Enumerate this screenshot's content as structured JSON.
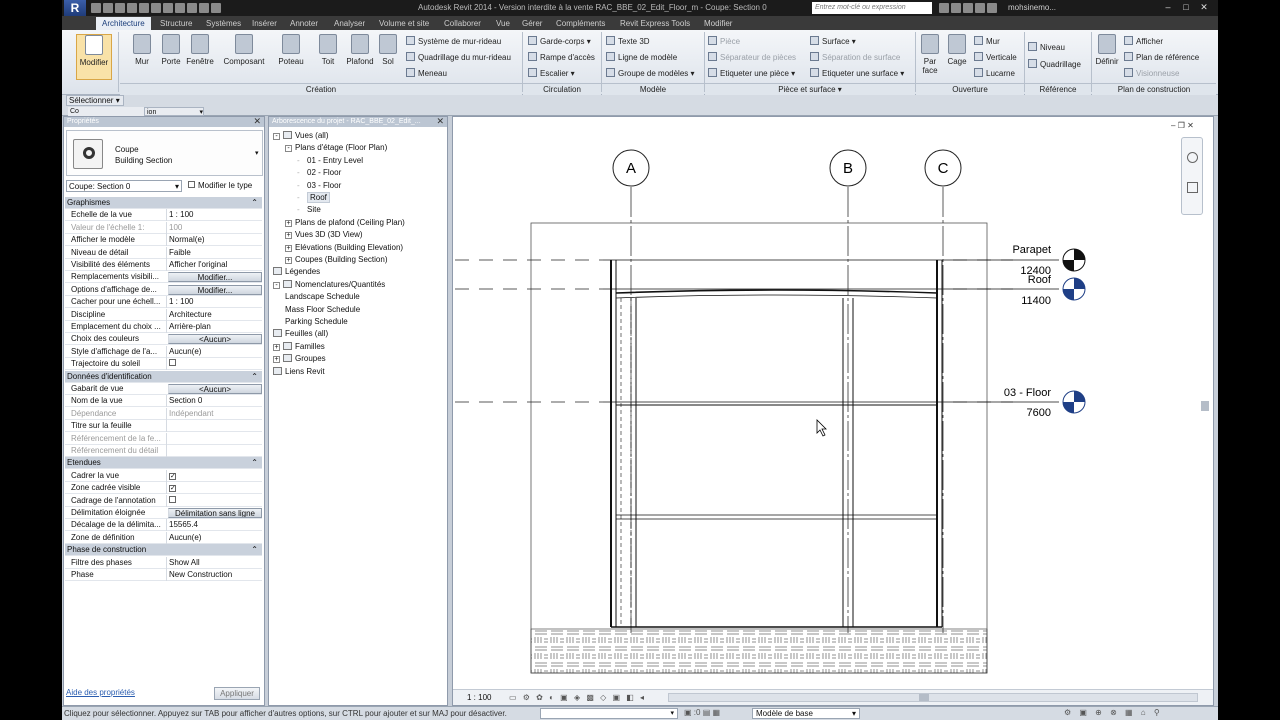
{
  "titlebar": {
    "title": "Autodesk Revit 2014 - Version interdite à la vente    RAC_BBE_02_Edit_Floor_m - Coupe: Section 0",
    "search_placeholder": "Entrez mot-clé ou expression",
    "user": "mohsinemo..."
  },
  "tabs": [
    "Architecture",
    "Structure",
    "Systèmes",
    "Insérer",
    "Annoter",
    "Analyser",
    "Volume et site",
    "Collaborer",
    "Vue",
    "Gérer",
    "Compléments",
    "Revit Express Tools",
    "Modifier"
  ],
  "ribbon": {
    "modify": "Modifier",
    "creation": {
      "label": "Création",
      "big": [
        "Mur",
        "Porte",
        "Fenêtre",
        "Composant",
        "Poteau",
        "Toit",
        "Plafond",
        "Sol"
      ],
      "small": [
        "Système de mur-rideau",
        "Quadrillage du mur-rideau",
        "Meneau"
      ]
    },
    "circulation": {
      "label": "Circulation",
      "items": [
        "Garde-corps",
        "Rampe d'accès",
        "Escalier"
      ]
    },
    "modele": {
      "label": "Modèle",
      "items": [
        "Texte 3D",
        "Ligne de modèle",
        "Groupe de modèles"
      ]
    },
    "piece": {
      "label": "Pièce et surface",
      "items": [
        "Pièce",
        "Séparateur de pièces",
        "Etiqueter une pièce",
        "Surface",
        "Séparation de surface",
        "Etiqueter une surface"
      ]
    },
    "ouverture": {
      "label": "Ouverture",
      "items": [
        "Par face",
        "Cage",
        "Mur",
        "Verticale",
        "Lucarne"
      ]
    },
    "reference": {
      "label": "Référence",
      "items": [
        "Niveau",
        "Quadrillage"
      ]
    },
    "plan": {
      "label": "Plan de construction",
      "items": [
        "Définir",
        "Afficher",
        "Plan de référence",
        "Visionneuse"
      ]
    }
  },
  "selectbar": {
    "label": "Sélectionner",
    "co": "Co",
    "ion": "ion"
  },
  "properties": {
    "title": "Propriétés",
    "type_line1": "Coupe",
    "type_line2": "Building Section",
    "selector": "Coupe: Section 0",
    "edit_type": "Modifier le type",
    "rows": [
      {
        "k": "Graphismes",
        "sec": true
      },
      {
        "k": "Echelle de la vue",
        "v": "1 : 100"
      },
      {
        "k": "Valeur de l'échelle   1:",
        "v": "100",
        "gray": true
      },
      {
        "k": "Afficher le modèle",
        "v": "Normal(e)"
      },
      {
        "k": "Niveau de détail",
        "v": "Faible"
      },
      {
        "k": "Visibilité des éléments",
        "v": "Afficher l'original"
      },
      {
        "k": "Remplacements visibili...",
        "v": "Modifier...",
        "btn": true
      },
      {
        "k": "Options d'affichage de...",
        "v": "Modifier...",
        "btn": true
      },
      {
        "k": "Cacher pour une échell...",
        "v": "1 : 100"
      },
      {
        "k": "Discipline",
        "v": "Architecture"
      },
      {
        "k": "Emplacement du choix ...",
        "v": "Arrière-plan"
      },
      {
        "k": "Choix des couleurs",
        "v": "<Aucun>",
        "btn": true
      },
      {
        "k": "Style d'affichage de l'a...",
        "v": "Aucun(e)"
      },
      {
        "k": "Trajectoire du soleil",
        "v": "",
        "chk": false
      },
      {
        "k": "Données d'identification",
        "sec": true
      },
      {
        "k": "Gabarit de vue",
        "v": "<Aucun>",
        "btn": true
      },
      {
        "k": "Nom de la vue",
        "v": "Section 0"
      },
      {
        "k": "Dépendance",
        "v": "Indépendant",
        "gray": true
      },
      {
        "k": "Titre sur la feuille",
        "v": ""
      },
      {
        "k": "Référencement de la fe...",
        "v": "",
        "gray": true
      },
      {
        "k": "Référencement du détail",
        "v": "",
        "gray": true
      },
      {
        "k": "Etendues",
        "sec": true
      },
      {
        "k": "Cadrer la vue",
        "v": "",
        "chk": true
      },
      {
        "k": "Zone cadrée visible",
        "v": "",
        "chk": true
      },
      {
        "k": "Cadrage de l'annotation",
        "v": "",
        "chk": false
      },
      {
        "k": "Délimitation éloignée",
        "v": "Délimitation sans ligne",
        "btn": true
      },
      {
        "k": "Décalage de la délimita...",
        "v": "15565.4"
      },
      {
        "k": "Zone de définition",
        "v": "Aucun(e)"
      },
      {
        "k": "Phase de construction",
        "sec": true
      },
      {
        "k": "Filtre des phases",
        "v": "Show All"
      },
      {
        "k": "Phase",
        "v": "New Construction"
      }
    ],
    "help": "Aide des propriétés",
    "apply": "Appliquer"
  },
  "browser": {
    "title": "Arborescence du projet - RAC_BBE_02_Edit_...",
    "items": [
      {
        "t": "Vues (all)",
        "lvl": 0,
        "ex": "-"
      },
      {
        "t": "Plans d'étage (Floor Plan)",
        "lvl": 1,
        "ex": "-"
      },
      {
        "t": "01 - Entry Level",
        "lvl": 2
      },
      {
        "t": "02 - Floor",
        "lvl": 2
      },
      {
        "t": "03 - Floor",
        "lvl": 2
      },
      {
        "t": "Roof",
        "lvl": 2,
        "sel": true
      },
      {
        "t": "Site",
        "lvl": 2
      },
      {
        "t": "Plans de plafond (Ceiling Plan)",
        "lvl": 1,
        "ex": "+"
      },
      {
        "t": "Vues 3D (3D View)",
        "lvl": 1,
        "ex": "+"
      },
      {
        "t": "Elévations (Building Elevation)",
        "lvl": 1,
        "ex": "+"
      },
      {
        "t": "Coupes (Building Section)",
        "lvl": 1,
        "ex": "+"
      },
      {
        "t": "Légendes",
        "lvl": 0
      },
      {
        "t": "Nomenclatures/Quantités",
        "lvl": 0,
        "ex": "-"
      },
      {
        "t": "Landscape Schedule",
        "lvl": 1
      },
      {
        "t": "Mass Floor Schedule",
        "lvl": 1
      },
      {
        "t": "Parking Schedule",
        "lvl": 1
      },
      {
        "t": "Feuilles (all)",
        "lvl": 0
      },
      {
        "t": "Familles",
        "lvl": 0,
        "ex": "+"
      },
      {
        "t": "Groupes",
        "lvl": 0,
        "ex": "+"
      },
      {
        "t": "Liens Revit",
        "lvl": 0
      }
    ]
  },
  "drawing": {
    "grids": [
      "A",
      "B",
      "C"
    ],
    "levels": [
      {
        "name": "Parapet",
        "elev": "12400"
      },
      {
        "name": "Roof",
        "elev": "11400"
      },
      {
        "name": "03 - Floor",
        "elev": "7600"
      }
    ],
    "scale": "1 : 100"
  },
  "status": {
    "text": "Cliquez pour sélectionner. Appuyez sur TAB pour afficher d'autres options, sur CTRL pour ajouter et sur MAJ pour désactiver.",
    "workset": "Modèle de base",
    "zero": ":0"
  }
}
